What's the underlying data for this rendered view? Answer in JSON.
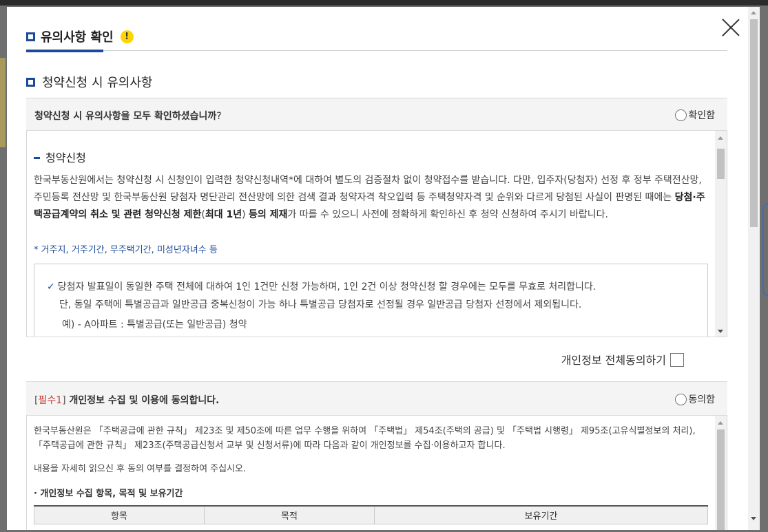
{
  "modal": {
    "title": "유의사항 확인",
    "warning_glyph": "!"
  },
  "section": {
    "title": "청약신청 시 유의사항"
  },
  "question1": {
    "text": "청약신청 시 유의사항을 모두 확인하셨습니까",
    "qmark": "?",
    "radio_label": "확인함"
  },
  "notice": {
    "subtitle": "청약신청",
    "para_part1": "한국부동산원에서는 청약신청 시 신청인이 입력한 청약신청내역*에 대하여 별도의 검증절차 없이 청약접수를 받습니다. 다만, 입주자(당첨자) 선정 후 정부 주택전산망, 주민등록 전산망 및 한국부동산원 당첨자 명단관리 전산망에 의한 검색 결과 청약자격 착오입력 등 주택청약자격 및 순위와 다르게 당첨된 사실이 판명된 때에는 ",
    "para_bold1": "당첨·주택공급계약의 취소 및 관련 청약신청 제한",
    "para_part2": "(",
    "para_bold2": "최대 1년",
    "para_part3": ") ",
    "para_bold3": "등의 제재",
    "para_part4": "가 따를 수 있으니 사전에 정확하게 확인하신 후 청약 신청하여 주시기 바랍니다.",
    "note": "* 거주지, 거주기간, 무주택기간, 미성년자녀수 등",
    "check_mark": "✓",
    "line1": "당첨자 발표일이 동일한 주택 전체에 대하여 1인 1건만 신청 가능하며, 1인 2건 이상 청약신청 할 경우에는 모두를 무효로 처리합니다.",
    "line2": "단, 동일 주택에 특별공급과 일반공급 중복신청이 가능 하나 특별공급 당첨자로 선정될 경우 일반공급 당첨자 선정에서 제외됩니다.",
    "line3": "예)  -  A아파트 : 특별공급(또는 일반공급) 청약"
  },
  "agree_all": {
    "label": "개인정보 전체동의하기"
  },
  "question2": {
    "bracket_open": "[",
    "required": "필수1",
    "bracket_close": "]",
    "text": " 개인정보 수집 및 이용에 동의합니다.",
    "radio_label": "동의함"
  },
  "privacy": {
    "p1": "한국부동산원은 「주택공급에 관한 규칙」 제23조 및 제50조에 따른 업무 수행을 위하여 「주택법」 제54조(주택의 공급) 및 「주택법 시행령」 제95조(고유식별정보의 처리), 「주택공급에 관한 규칙」 제23조(주택공급신청서 교부 및 신청서류)에 따라 다음과 같이 개인정보를 수집·이용하고자 합니다.",
    "p2": "내용을 자세히 읽으신 후 동의 여부를 결정하여 주십시오.",
    "p3": "· 개인정보 수집 항목, 목적 및 보유기간",
    "table_headers": [
      "항목",
      "목적",
      "보유기간"
    ]
  },
  "colors": {
    "accent_blue": "#1a4a9a",
    "required_red": "#c0392b",
    "warning_yellow": "#ffd400"
  }
}
